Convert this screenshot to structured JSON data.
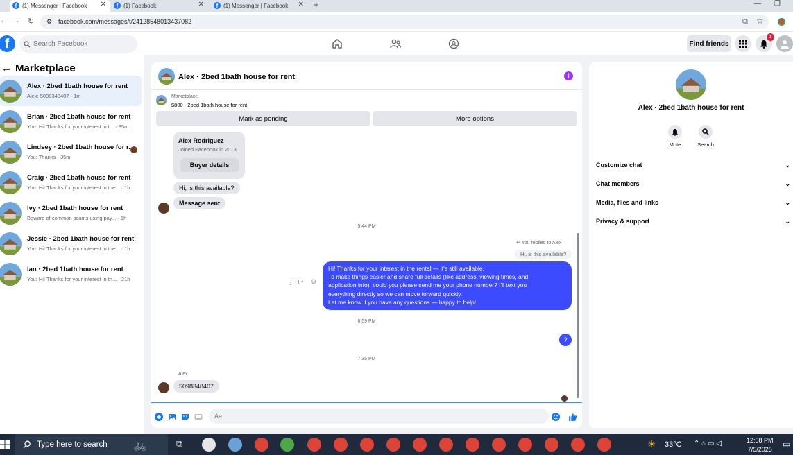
{
  "tabs": [
    {
      "label": "(1) Messenger | Facebook",
      "active": true
    },
    {
      "label": "(1) Facebook",
      "active": false
    },
    {
      "label": "(1) Messenger | Facebook",
      "active": false
    }
  ],
  "address_bar": {
    "url": "facebook.com/messages/t/24128548013437082"
  },
  "header": {
    "search_placeholder": "Search Facebook",
    "find_friends_label": "Find friends",
    "notification_count": "1"
  },
  "sidebar": {
    "title": "Marketplace",
    "conversations": [
      {
        "name": "Alex · 2bed 1bath house for rent",
        "preview": "Alex: 5098348407 · 1m",
        "active": true
      },
      {
        "name": "Brian · 2bed 1bath house for rent",
        "preview": "You: Hi! Thanks for your interest in t... · 35m"
      },
      {
        "name": "Lindsey · 2bed 1bath house for r...",
        "preview": "You: Thanks · 35m"
      },
      {
        "name": "Craig · 2bed 1bath house for rent",
        "preview": "You: Hi! Thanks for your interest in the... · 1h"
      },
      {
        "name": "Ivy · 2bed 1bath house for rent",
        "preview": "Beware of common scams using pay... · 1h"
      },
      {
        "name": "Jessie · 2bed 1bath house for rent",
        "preview": "You: Hi! Thanks for your interest in the... · 1h"
      },
      {
        "name": "Ian · 2bed 1bath house for rent",
        "preview": "You: Hi! Thanks for your interest in th... · 21h"
      }
    ]
  },
  "chat": {
    "title": "Alex · 2bed 1bath house for rent",
    "marketplace_label": "Marketplace",
    "listing": "$800 · 2bed 1bath house for rent",
    "mark_pending_label": "Mark as pending",
    "more_options_label": "More options",
    "buyer": {
      "name": "Alex Rodriguez",
      "joined": "Joined Facebook in 2013",
      "button_label": "Buyer details"
    },
    "msg_available": "Hi, is this available?",
    "msg_sent": "Message sent",
    "time1": "5:44 PM",
    "replied_to": "You replied to Alex",
    "quoted": "Hi, is this available?",
    "outgoing_lines": [
      "Hi! Thanks for your interest in the rental — it's still available.",
      "To make things easier and share full details (like address, viewing times, and",
      "application info), could you please send me your phone number? I'll text you",
      "everything directly so we can move forward quickly.",
      "Let me know if you have any questions — happy to help!"
    ],
    "time2": "6:59 PM",
    "question_msg": "?",
    "time3": "7:35 PM",
    "sender_label": "Alex",
    "phone_msg": "5098348407",
    "composer_placeholder": "Aa"
  },
  "details": {
    "title": "Alex · 2bed 1bath house for rent",
    "mute_label": "Mute",
    "search_label": "Search",
    "rows": [
      "Customize chat",
      "Chat members",
      "Media, files and links",
      "Privacy & support"
    ]
  },
  "taskbar": {
    "search_placeholder": "Type here to search",
    "temperature": "33°C",
    "time": "12:08 PM",
    "date": "7/5/2025"
  },
  "colors": {
    "accent": "#1877f2",
    "outgoing_bubble": "#3d4bff",
    "badge": "#e41e3f"
  }
}
